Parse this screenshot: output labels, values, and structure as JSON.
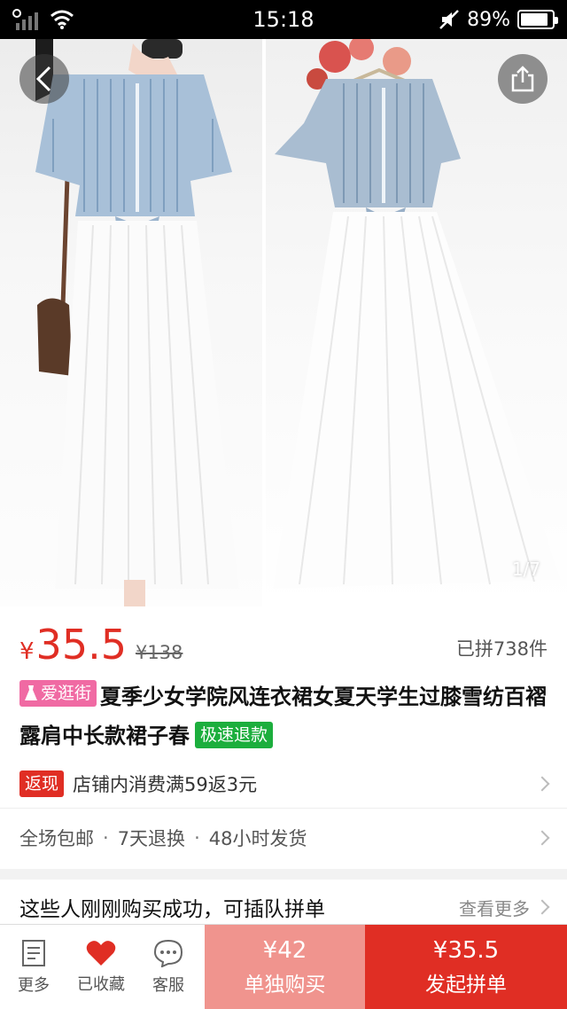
{
  "status_bar": {
    "time": "15:18",
    "battery": "89%",
    "battery_level": 0.89
  },
  "gallery": {
    "page_indicator": "1/7"
  },
  "product": {
    "price_symbol": "¥",
    "price": "35.5",
    "original_price": "¥138",
    "sold_count": "已拼738件",
    "tag_label": "爱逛街",
    "title": "夏季少女学院风连衣裙女夏天学生过膝雪纺百褶露肩中长款裙子春",
    "fast_refund_tag": "极速退款",
    "cashback_badge": "返现",
    "cashback_text": "店铺内消费满59返3元",
    "services": [
      "全场包邮",
      "7天退换",
      "48小时发货"
    ],
    "service_separator": "·"
  },
  "section": {
    "title": "这些人刚刚购买成功，可插队拼单",
    "more": "查看更多"
  },
  "bottom_bar": {
    "more_label": "更多",
    "favorited_label": "已收藏",
    "service_label": "客服",
    "solo_price": "¥42",
    "solo_label": "单独购买",
    "group_price": "¥35.5",
    "group_label": "发起拼单"
  },
  "colors": {
    "accent_red": "#e02e24",
    "solo_pink": "#f0948e",
    "tag_pink": "#f06aa3",
    "tag_green": "#1cae3d"
  }
}
